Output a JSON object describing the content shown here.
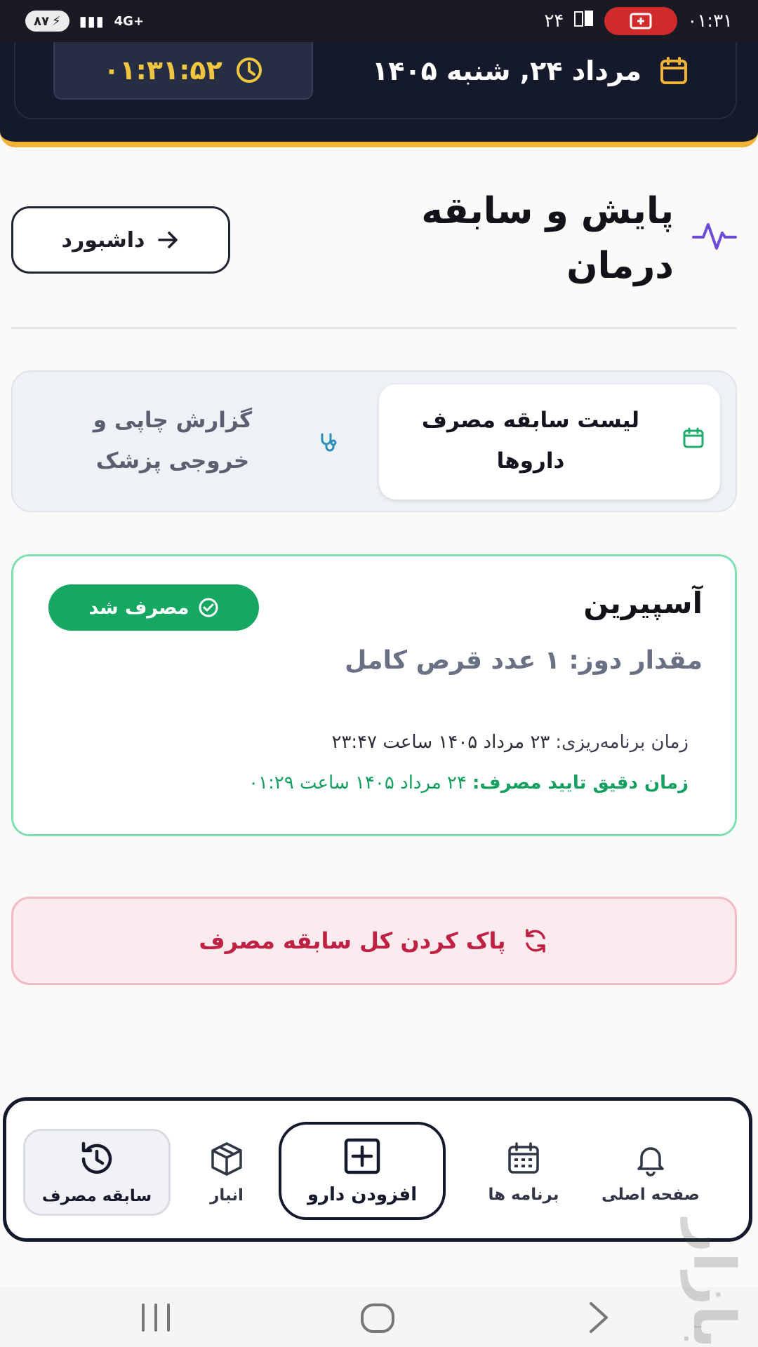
{
  "status_bar": {
    "battery": "۸۷",
    "network": "4G+",
    "notification_count": "۲۴",
    "time": "۰۱:۳۱"
  },
  "header": {
    "clock": "۰۱:۳۱:۵۲",
    "date": "مرداد ۲۴, شنبه ۱۴۰۵"
  },
  "page": {
    "title": "پایش و سابقه درمان",
    "dashboard_button": "داشبورد"
  },
  "tabs": [
    {
      "label": "لیست سابقه مصرف داروها",
      "active": true
    },
    {
      "label": "گزارش چاپی و خروجی پزشک",
      "active": false
    }
  ],
  "record": {
    "drug_name": "آسپیرین",
    "status_badge": "مصرف شد",
    "dose": "مقدار دوز: ۱ عدد قرص کامل",
    "scheduled_label": "زمان برنامه‌ریزی:",
    "scheduled_value": "۲۳ مرداد ۱۴۰۵ ساعت ۲۳:۴۷",
    "confirmed_label": "زمان دقیق تایید مصرف:",
    "confirmed_value": "۲۴ مرداد ۱۴۰۵ ساعت ۰۱:۲۹"
  },
  "clear_button": "پاک کردن کل سابقه مصرف",
  "bottom_nav": {
    "home": "صفحه اصلی",
    "schedules": "برنامه ها",
    "add_drug": "افزودن دارو",
    "inventory": "انبار",
    "history": "سابقه مصرف"
  },
  "colors": {
    "header_bg": "#141a2b",
    "accent_gold": "#f0b338",
    "success_green": "#16a862",
    "danger_red": "#c02042"
  }
}
